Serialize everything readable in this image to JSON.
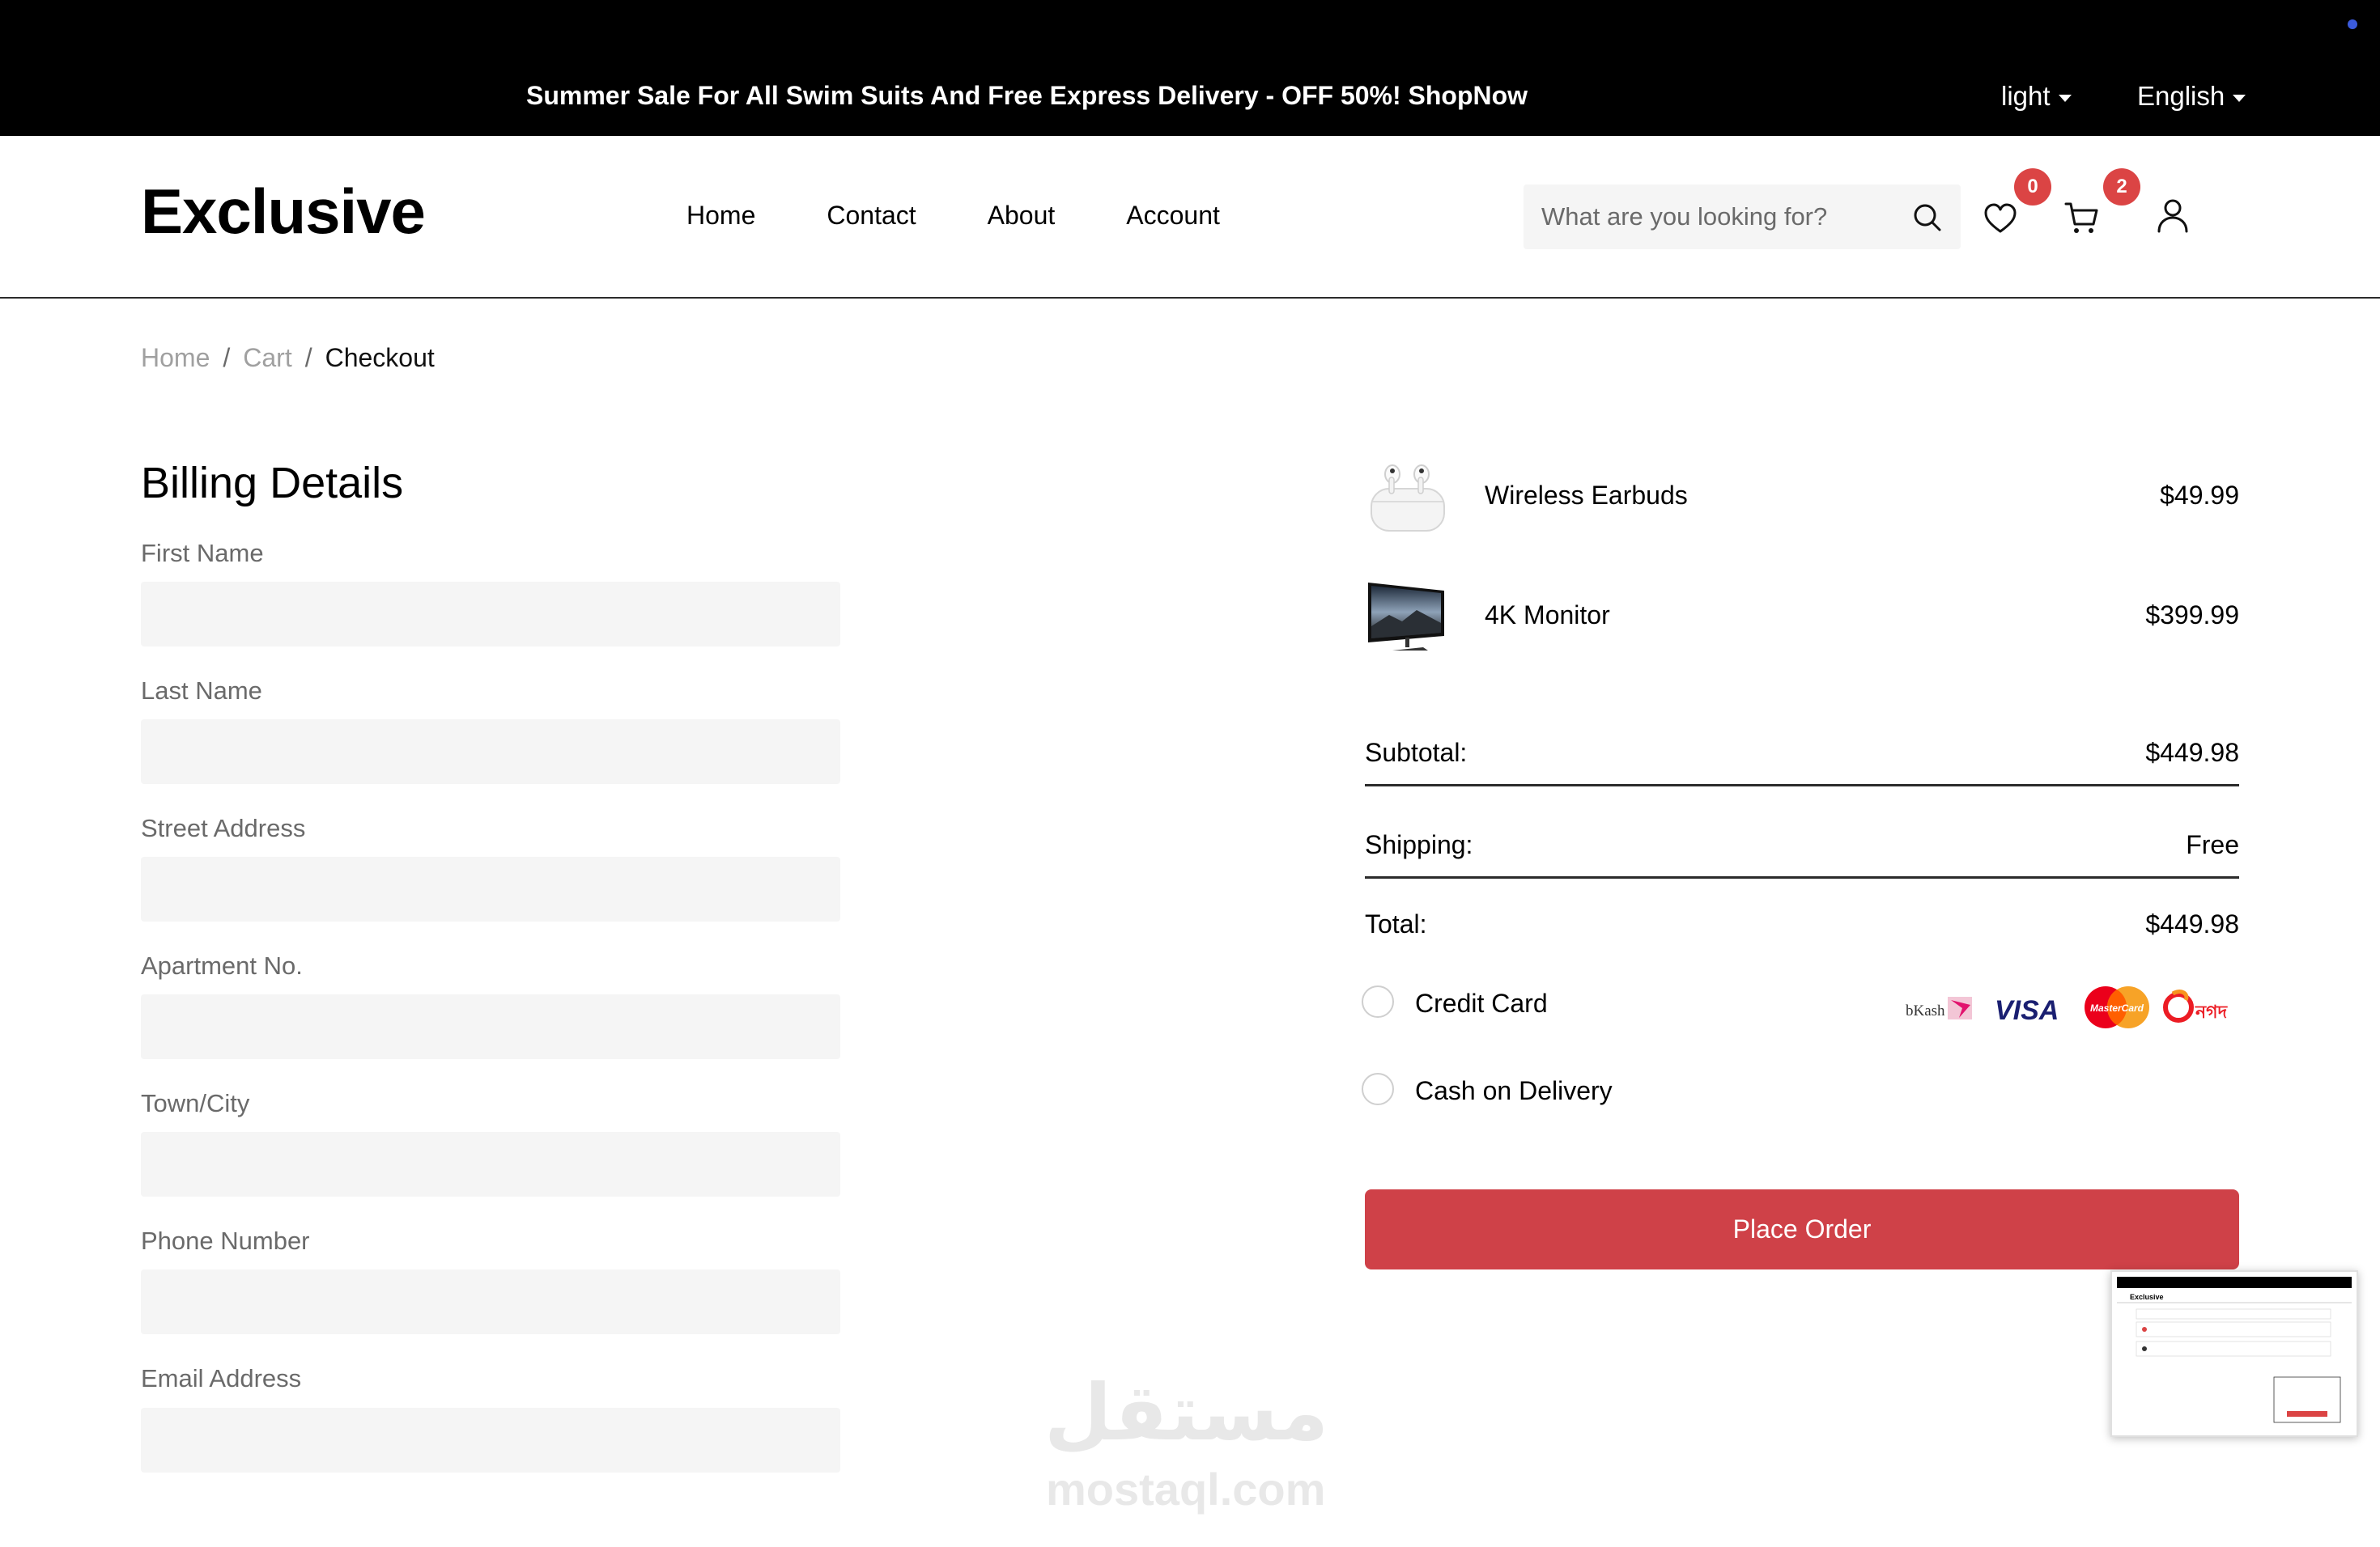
{
  "topbar": {
    "promo_text": "Summer Sale For All Swim Suits And Free Express Delivery - OFF 50%!",
    "promo_link": "ShopNow",
    "theme_selector": "light",
    "language_selector": "English"
  },
  "header": {
    "logo": "Exclusive",
    "nav": [
      "Home",
      "Contact",
      "About",
      "Account"
    ],
    "search_placeholder": "What are you looking for?",
    "wishlist_count": "0",
    "cart_count": "2",
    "icons": [
      "search-icon",
      "heart-icon",
      "cart-icon",
      "user-icon"
    ]
  },
  "breadcrumb": [
    "Home",
    "Cart",
    "Checkout"
  ],
  "billing": {
    "title": "Billing Details",
    "fields": [
      {
        "label": "First Name",
        "value": ""
      },
      {
        "label": "Last Name",
        "value": ""
      },
      {
        "label": "Street Address",
        "value": ""
      },
      {
        "label": "Apartment No.",
        "value": ""
      },
      {
        "label": "Town/City",
        "value": ""
      },
      {
        "label": "Phone Number",
        "value": ""
      },
      {
        "label": "Email Address",
        "value": ""
      }
    ]
  },
  "order": {
    "items": [
      {
        "name": "Wireless Earbuds",
        "price": "$49.99",
        "icon": "earbuds-image"
      },
      {
        "name": "4K Monitor",
        "price": "$399.99",
        "icon": "monitor-image"
      }
    ],
    "subtotal_label": "Subtotal:",
    "subtotal": "$449.98",
    "shipping_label": "Shipping:",
    "shipping": "Free",
    "total_label": "Total:",
    "total": "$449.98",
    "payment_options": [
      "Credit Card",
      "Cash on Delivery"
    ],
    "payment_logos": {
      "bkash": "bKash",
      "visa": "VISA",
      "mastercard": "MasterCard",
      "nagad": "নগদ"
    },
    "place_order": "Place Order"
  },
  "thumbnail": {
    "logo": "Exclusive"
  },
  "watermark": {
    "arabic": "مستقل",
    "latin": "mostaql.com"
  },
  "colors": {
    "topbar_bg": "#000000",
    "badge": "#db4444",
    "place_order_bg": "#cf4148",
    "input_bg": "#f5f5f5"
  }
}
